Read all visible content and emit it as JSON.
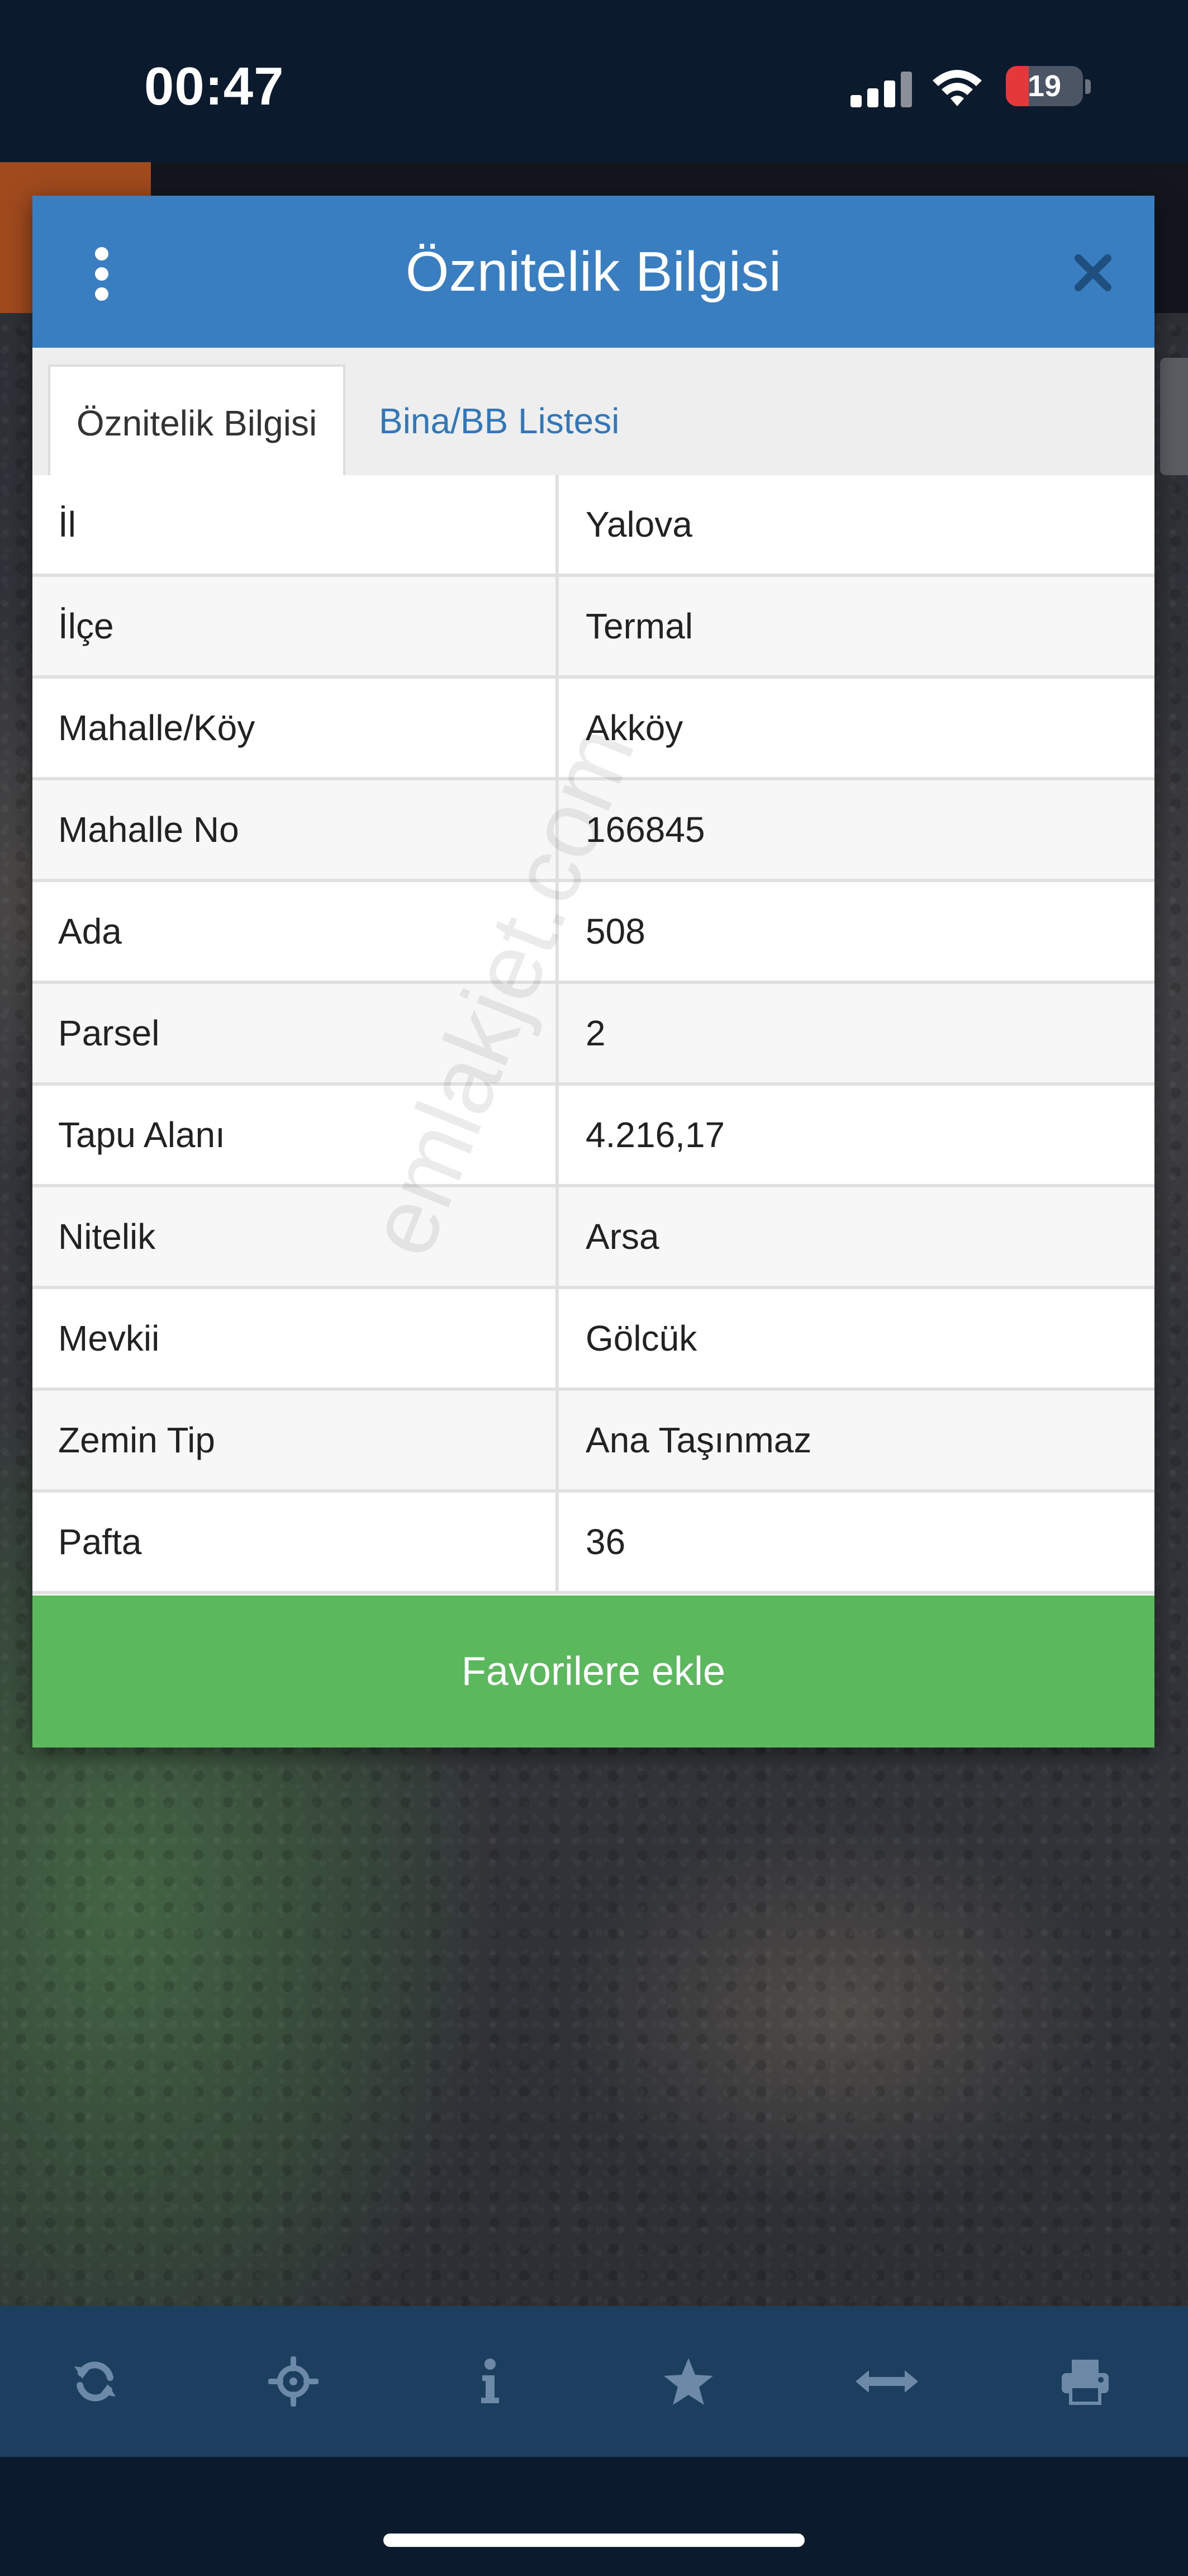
{
  "status_bar": {
    "time": "00:47",
    "battery_level": "19",
    "icons": [
      "signal-icon",
      "wifi-icon",
      "battery-icon"
    ]
  },
  "dialog": {
    "title": "Öznitelik Bilgisi",
    "menu_icon": "more-vertical-icon",
    "close_icon": "close-icon",
    "tabs": [
      {
        "label": "Öznitelik Bilgisi",
        "active": true
      },
      {
        "label": "Bina/BB Listesi",
        "active": false
      }
    ],
    "rows": [
      {
        "label": "İl",
        "value": "Yalova"
      },
      {
        "label": "İlçe",
        "value": "Termal"
      },
      {
        "label": "Mahalle/Köy",
        "value": "Akköy"
      },
      {
        "label": "Mahalle No",
        "value": "166845"
      },
      {
        "label": "Ada",
        "value": "508"
      },
      {
        "label": "Parsel",
        "value": "2"
      },
      {
        "label": "Tapu Alanı",
        "value": "4.216,17"
      },
      {
        "label": "Nitelik",
        "value": "Arsa"
      },
      {
        "label": "Mevkii",
        "value": "Gölcük"
      },
      {
        "label": "Zemin Tip",
        "value": "Ana Taşınmaz"
      },
      {
        "label": "Pafta",
        "value": "36"
      }
    ],
    "favorite_button": "Favorilere ekle"
  },
  "watermark": "emlakjet.com",
  "toolbar": {
    "icons": [
      "refresh-icon",
      "locate-icon",
      "info-icon",
      "star-icon",
      "measure-icon",
      "print-icon"
    ]
  },
  "colors": {
    "header_blue": "#3a7ec2",
    "tab_link": "#3278b8",
    "button_green": "#5cb85c",
    "toolbar_bg": "#1c3f5f",
    "toolbar_icon": "#6c8aa8",
    "battery_red": "#e5383b"
  }
}
